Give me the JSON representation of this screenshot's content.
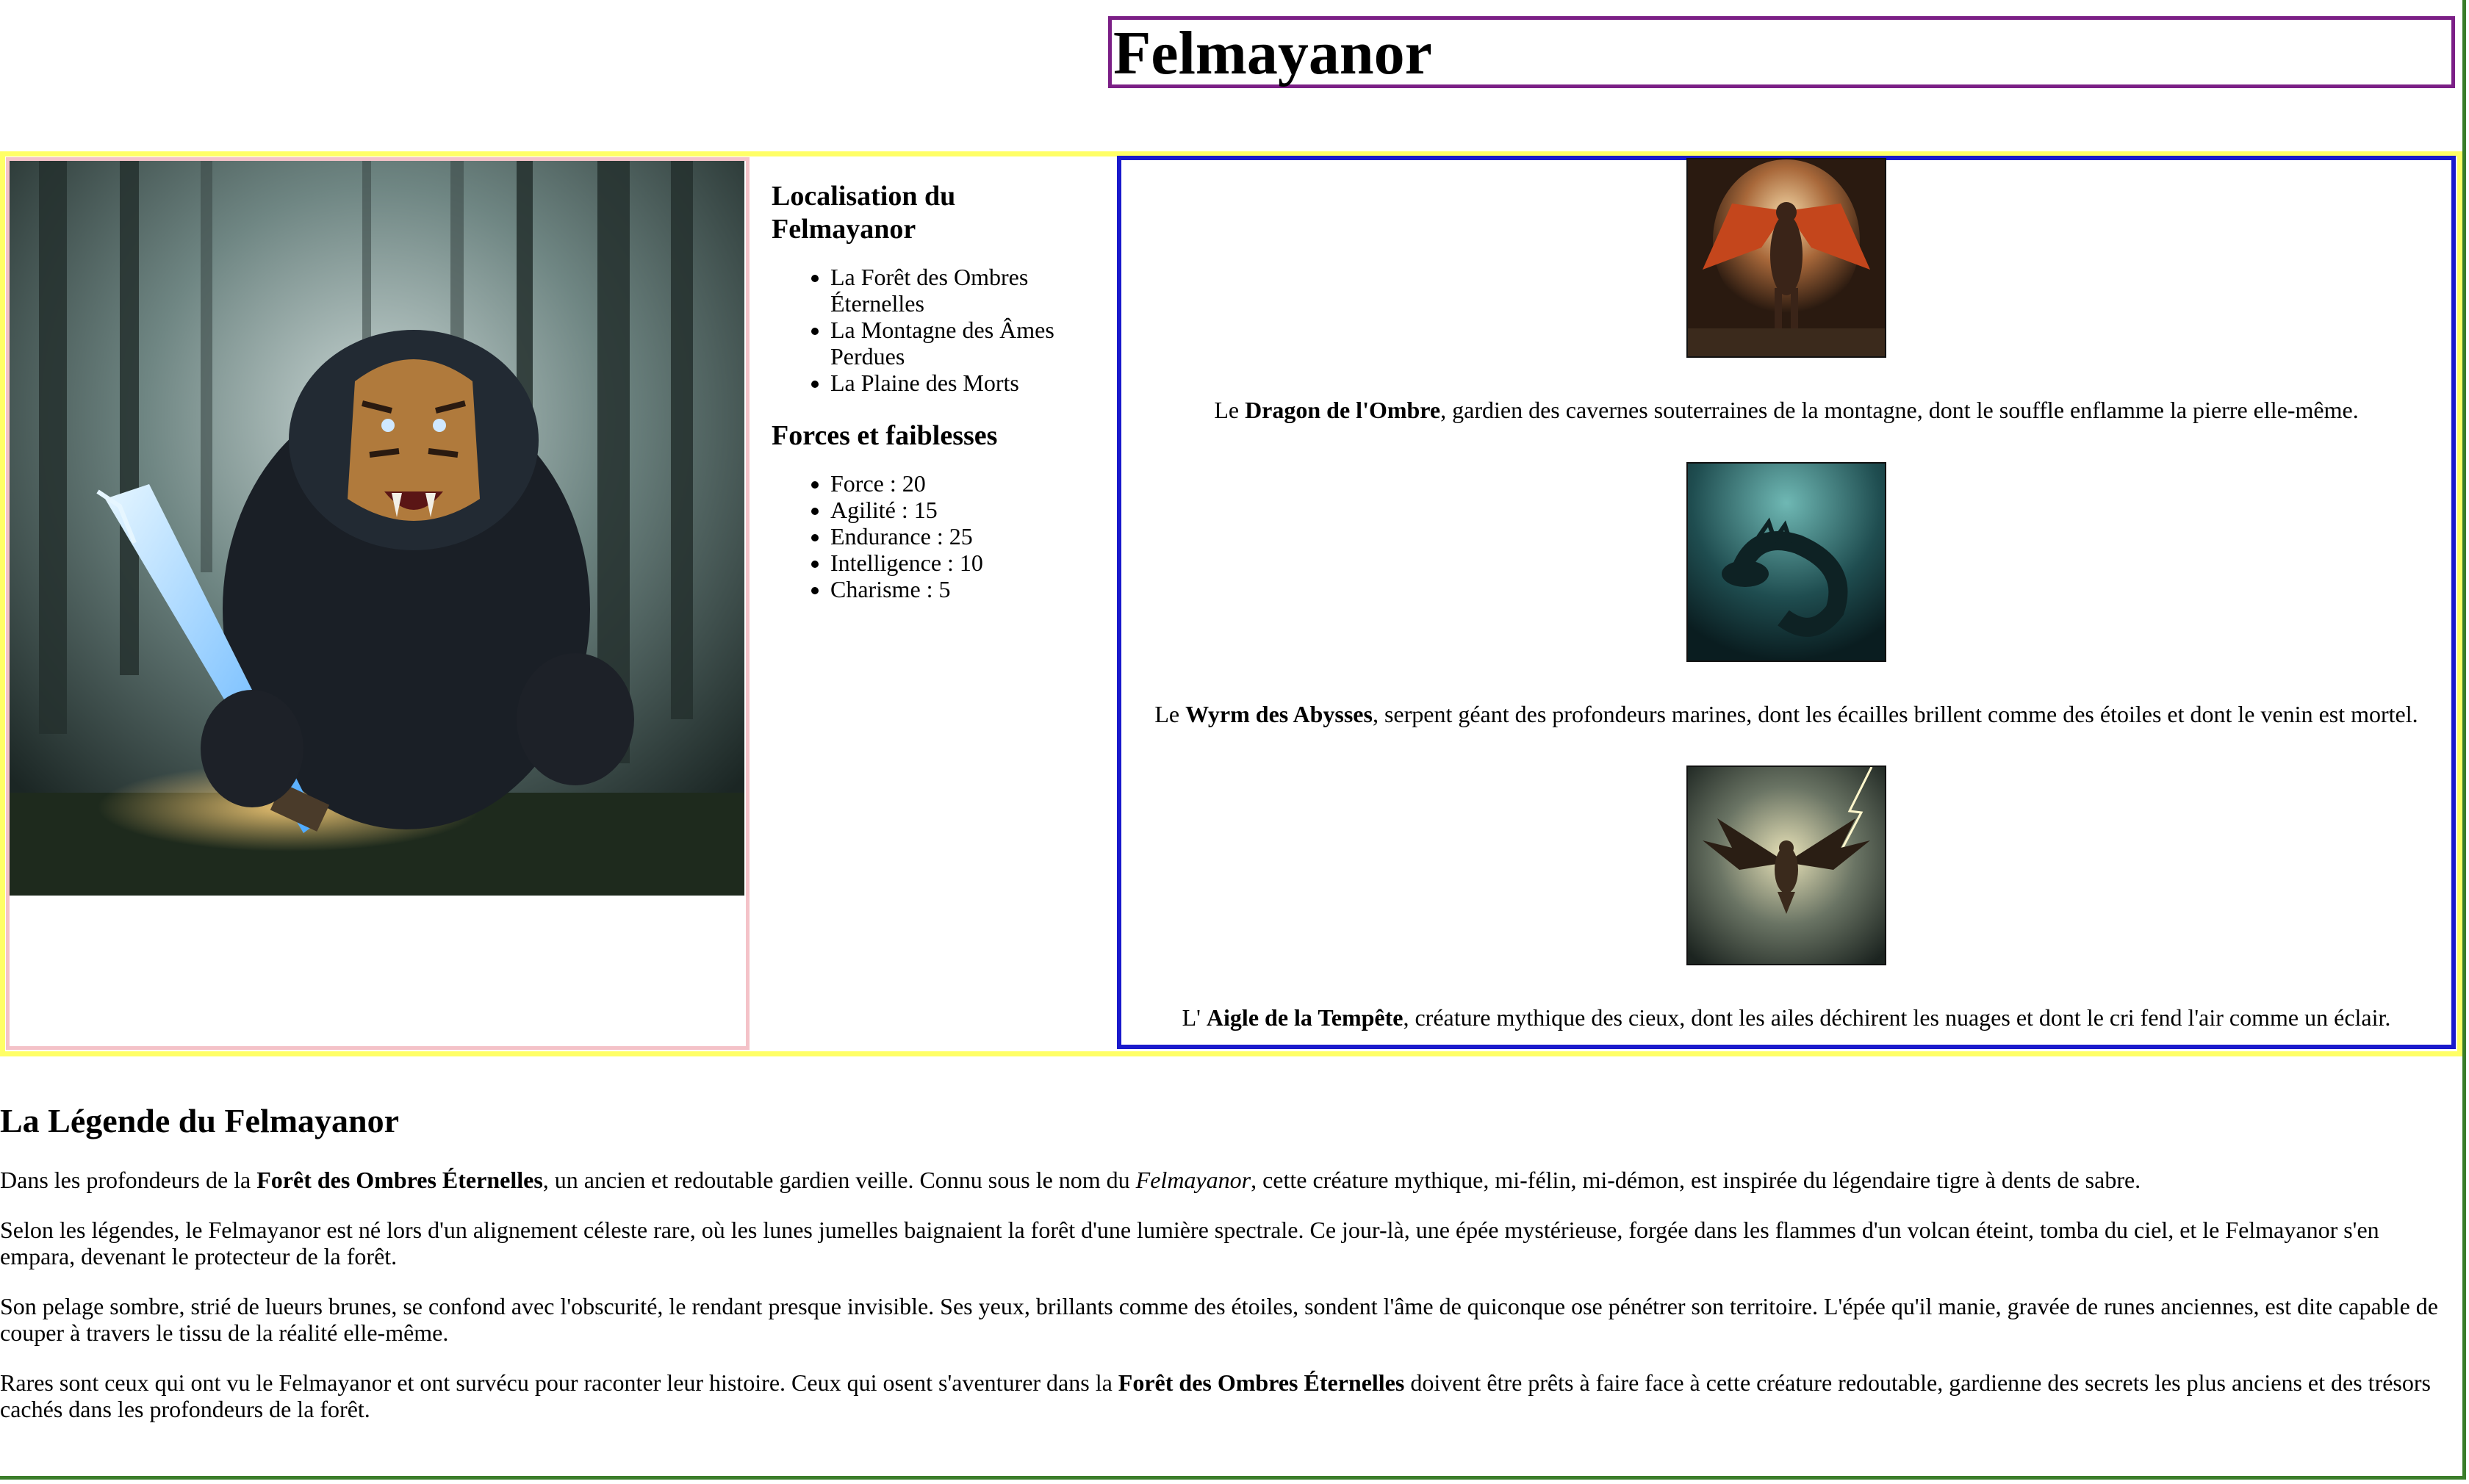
{
  "title": "Felmayanor",
  "sidebar": {
    "location_heading": "Localisation du Felmayanor",
    "locations": [
      "La Forêt des Ombres Éternelles",
      "La Montagne des Âmes Perdues",
      "La Plaine des Morts"
    ],
    "stats_heading": "Forces et faiblesses",
    "stats": [
      "Force : 20",
      "Agilité : 15",
      "Endurance : 25",
      "Intelligence : 10",
      "Charisme : 5"
    ]
  },
  "creatures": [
    {
      "prefix": "Le ",
      "name": "Dragon de l'Ombre",
      "desc": ", gardien des cavernes souterraines de la montagne, dont le souffle enflamme la pierre elle-même."
    },
    {
      "prefix": "Le ",
      "name": "Wyrm des Abysses",
      "desc": ", serpent géant des profondeurs marines, dont les écailles brillent comme des étoiles et dont le venin est mortel."
    },
    {
      "prefix": "L' ",
      "name": "Aigle de la Tempête",
      "desc": ", créature mythique des cieux, dont les ailes déchirent les nuages et dont le cri fend l'air comme un éclair."
    }
  ],
  "legend": {
    "heading": "La Légende du Felmayanor",
    "p1": {
      "a": "Dans les profondeurs de la ",
      "b": "Forêt des Ombres Éternelles",
      "c": ", un ancien et redoutable gardien veille. Connu sous le nom du ",
      "d": "Felmayanor",
      "e": ", cette créature mythique, mi-félin, mi-démon, est inspirée du légendaire tigre à dents de sabre."
    },
    "p2": "Selon les légendes, le Felmayanor est né lors d'un alignement céleste rare, où les lunes jumelles baignaient la forêt d'une lumière spectrale. Ce jour-là, une épée mystérieuse, forgée dans les flammes d'un volcan éteint, tomba du ciel, et le Felmayanor s'en empara, devenant le protecteur de la forêt.",
    "p3": "Son pelage sombre, strié de lueurs brunes, se confond avec l'obscurité, le rendant presque invisible. Ses yeux, brillants comme des étoiles, sondent l'âme de quiconque ose pénétrer son territoire. L'épée qu'il manie, gravée de runes anciennes, est dite capable de couper à travers le tissu de la réalité elle-même.",
    "p4": {
      "a": "Rares sont ceux qui ont vu le Felmayanor et ont survécu pour raconter leur histoire. Ceux qui osent s'aventurer dans la ",
      "b": "Forêt des Ombres Éternelles",
      "c": " doivent être prêts à faire face à cette créature redoutable, gardienne des secrets les plus anciens et des trésors cachés dans les profondeurs de la forêt."
    }
  },
  "colors": {
    "outer_border": "#3a7d2a",
    "title_border": "#7b1f86",
    "row_border": "#ffff66",
    "hero_border": "#f4c2c8",
    "creatures_border": "#1a1acc"
  },
  "icons": {
    "hero": "felmayanor-image",
    "creature_1": "dragon-image",
    "creature_2": "wyrm-image",
    "creature_3": "eagle-image"
  }
}
